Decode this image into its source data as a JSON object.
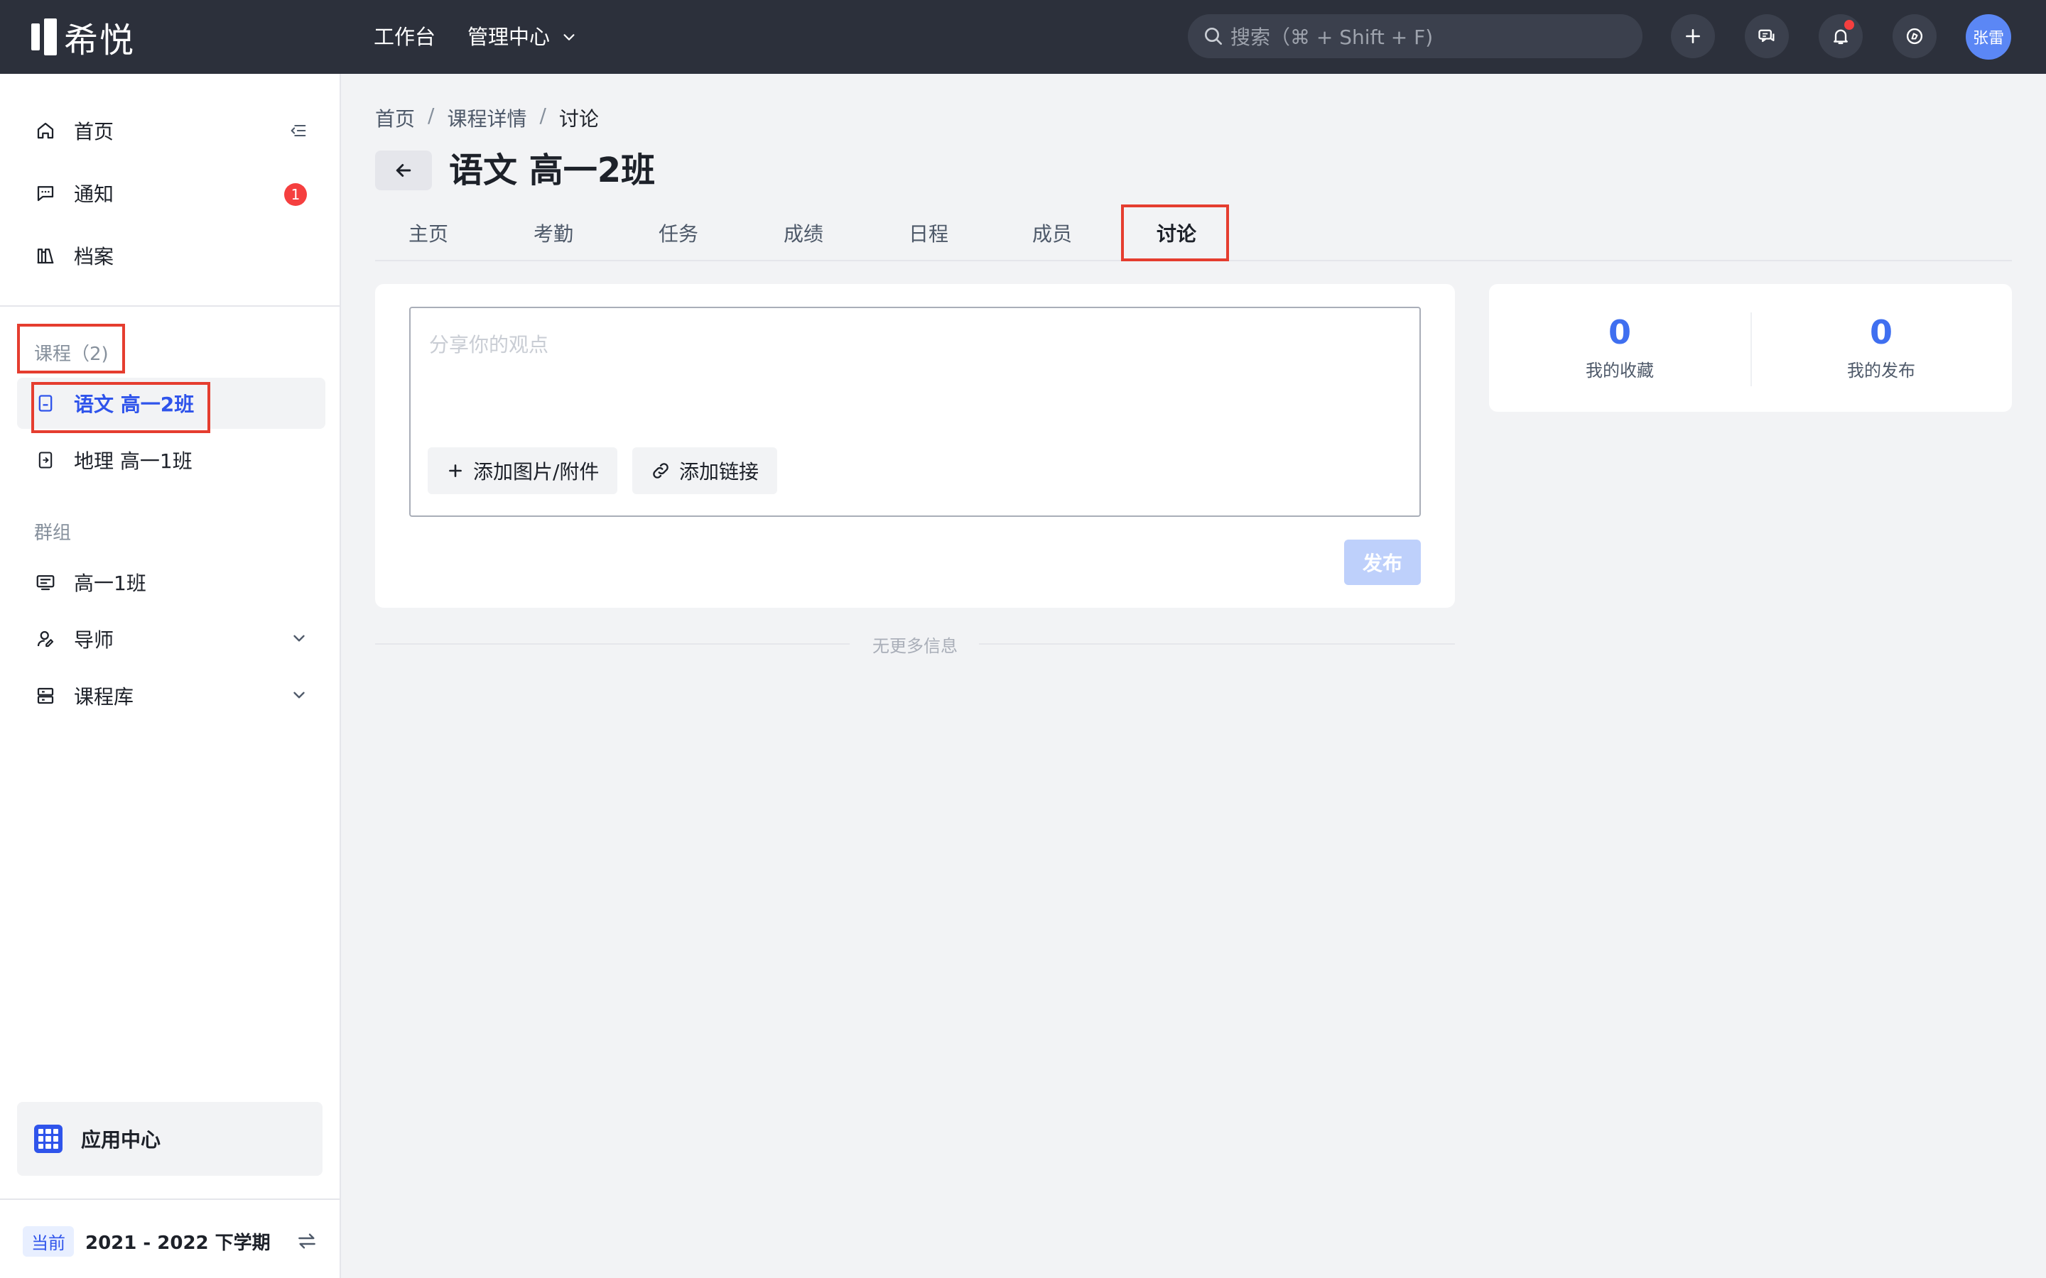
{
  "app": {
    "logo_text": "希悦"
  },
  "topbar": {
    "nav": [
      "工作台",
      "管理中心"
    ],
    "search_placeholder": "搜索（⌘ + Shift + F)",
    "avatar_text": "张雷",
    "icons": [
      "plus-icon",
      "chat-icon",
      "bell-icon",
      "compass-icon"
    ],
    "notification_dot_color": "#f53f3f"
  },
  "sidebar": {
    "main_items": [
      {
        "label": "首页",
        "icon": "home-icon"
      },
      {
        "label": "通知",
        "icon": "message-icon",
        "badge": "1"
      },
      {
        "label": "档案",
        "icon": "archive-icon"
      }
    ],
    "courses_label": "课程（2)",
    "courses": [
      {
        "label": "语文 高一2班",
        "active": true
      },
      {
        "label": "地理 高一1班",
        "active": false
      }
    ],
    "groups_label": "群组",
    "groups": [
      {
        "label": "高一1班"
      },
      {
        "label": "导师",
        "expandable": true
      },
      {
        "label": "课程库",
        "expandable": true
      }
    ],
    "app_center_label": "应用中心",
    "term_tag": "当前",
    "term_label": "2021 - 2022 下学期"
  },
  "breadcrumb": [
    "首页",
    "课程详情",
    "讨论"
  ],
  "page_title": "语文 高一2班",
  "tabs": [
    "主页",
    "考勤",
    "任务",
    "成绩",
    "日程",
    "成员",
    "讨论"
  ],
  "active_tab": "讨论",
  "composer": {
    "placeholder": "分享你的观点",
    "add_attachment_label": "添加图片/附件",
    "add_link_label": "添加链接",
    "publish_label": "发布"
  },
  "feed_end_text": "无更多信息",
  "stats": [
    {
      "value": "0",
      "label": "我的收藏"
    },
    {
      "value": "0",
      "label": "我的发布"
    }
  ],
  "colors": {
    "topbar_bg": "#2c303b",
    "accent": "#2f54eb",
    "highlight_box": "#e53d2f",
    "badge": "#f53f3f"
  }
}
